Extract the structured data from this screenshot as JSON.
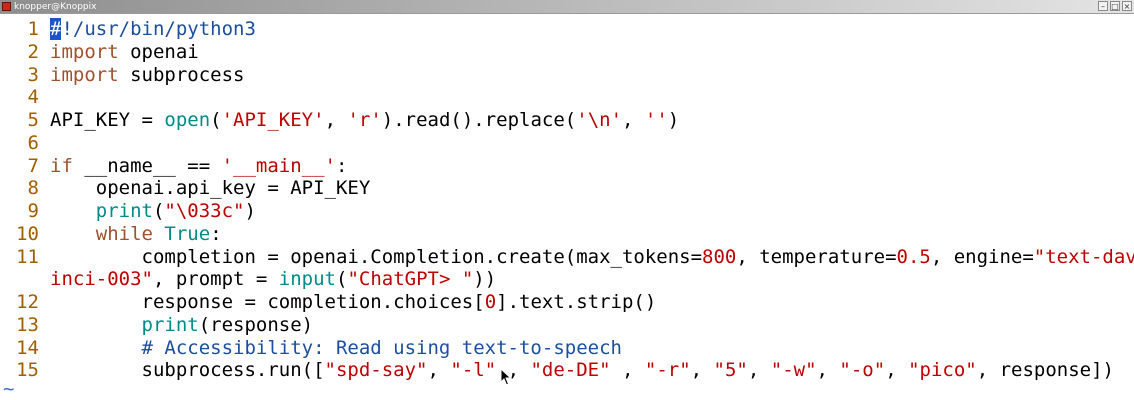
{
  "window": {
    "title": "knopper@Knoppix",
    "buttons": [
      "–",
      "□",
      "×"
    ]
  },
  "editor": {
    "lines": [
      {
        "number": "1",
        "tokens": [
          {
            "t": "#",
            "c": "cursor"
          },
          {
            "t": "!/usr/bin/python3",
            "c": "cm"
          }
        ]
      },
      {
        "number": "2",
        "tokens": [
          {
            "t": "import",
            "c": "kw"
          },
          {
            "t": " openai",
            "c": ""
          }
        ]
      },
      {
        "number": "3",
        "tokens": [
          {
            "t": "import",
            "c": "kw"
          },
          {
            "t": " subprocess",
            "c": ""
          }
        ]
      },
      {
        "number": "4",
        "tokens": []
      },
      {
        "number": "5",
        "tokens": [
          {
            "t": "API_KEY = ",
            "c": ""
          },
          {
            "t": "open",
            "c": "bi"
          },
          {
            "t": "(",
            "c": ""
          },
          {
            "t": "'API_KEY'",
            "c": "st"
          },
          {
            "t": ", ",
            "c": ""
          },
          {
            "t": "'r'",
            "c": "st"
          },
          {
            "t": ").read().replace(",
            "c": ""
          },
          {
            "t": "'\\n'",
            "c": "st"
          },
          {
            "t": ", ",
            "c": ""
          },
          {
            "t": "''",
            "c": "st"
          },
          {
            "t": ")",
            "c": ""
          }
        ]
      },
      {
        "number": "6",
        "tokens": []
      },
      {
        "number": "7",
        "tokens": [
          {
            "t": "if",
            "c": "kw"
          },
          {
            "t": " __name__ == ",
            "c": ""
          },
          {
            "t": "'__main__'",
            "c": "st"
          },
          {
            "t": ":",
            "c": ""
          }
        ]
      },
      {
        "number": "8",
        "tokens": [
          {
            "t": "    openai.api_key = API_KEY",
            "c": ""
          }
        ]
      },
      {
        "number": "9",
        "tokens": [
          {
            "t": "    ",
            "c": ""
          },
          {
            "t": "print",
            "c": "bi"
          },
          {
            "t": "(",
            "c": ""
          },
          {
            "t": "\"\\033c\"",
            "c": "st"
          },
          {
            "t": ")",
            "c": ""
          }
        ]
      },
      {
        "number": "10",
        "tokens": [
          {
            "t": "    ",
            "c": ""
          },
          {
            "t": "while",
            "c": "kw"
          },
          {
            "t": " ",
            "c": ""
          },
          {
            "t": "True",
            "c": "bi"
          },
          {
            "t": ":",
            "c": ""
          }
        ]
      },
      {
        "number": "11",
        "tokens": [
          {
            "t": "        completion = openai.Completion.create(max_tokens=",
            "c": ""
          },
          {
            "t": "800",
            "c": "num"
          },
          {
            "t": ", temperature=",
            "c": ""
          },
          {
            "t": "0.5",
            "c": "num"
          },
          {
            "t": ", engine=",
            "c": ""
          },
          {
            "t": "\"text-dav",
            "c": "st"
          }
        ]
      },
      {
        "number": "",
        "tokens": [
          {
            "t": "inci-003\"",
            "c": "st"
          },
          {
            "t": ", prompt = ",
            "c": ""
          },
          {
            "t": "input",
            "c": "bi"
          },
          {
            "t": "(",
            "c": ""
          },
          {
            "t": "\"ChatGPT> \"",
            "c": "st"
          },
          {
            "t": "))",
            "c": ""
          }
        ]
      },
      {
        "number": "12",
        "tokens": [
          {
            "t": "        response = completion.choices[",
            "c": ""
          },
          {
            "t": "0",
            "c": "num"
          },
          {
            "t": "].text.strip()",
            "c": ""
          }
        ]
      },
      {
        "number": "13",
        "tokens": [
          {
            "t": "        ",
            "c": ""
          },
          {
            "t": "print",
            "c": "bi"
          },
          {
            "t": "(response)",
            "c": ""
          }
        ]
      },
      {
        "number": "14",
        "tokens": [
          {
            "t": "        # Accessibility: Read using text-to-speech",
            "c": "cm"
          }
        ]
      },
      {
        "number": "15",
        "tokens": [
          {
            "t": "        subprocess.run([",
            "c": ""
          },
          {
            "t": "\"spd-say\"",
            "c": "st"
          },
          {
            "t": ", ",
            "c": ""
          },
          {
            "t": "\"-l\"",
            "c": "st"
          },
          {
            "t": " , ",
            "c": ""
          },
          {
            "t": "\"de-DE\"",
            "c": "st"
          },
          {
            "t": " , ",
            "c": ""
          },
          {
            "t": "\"-r\"",
            "c": "st"
          },
          {
            "t": ", ",
            "c": ""
          },
          {
            "t": "\"5\"",
            "c": "st"
          },
          {
            "t": ", ",
            "c": ""
          },
          {
            "t": "\"-w\"",
            "c": "st"
          },
          {
            "t": ", ",
            "c": ""
          },
          {
            "t": "\"-o\"",
            "c": "st"
          },
          {
            "t": ", ",
            "c": ""
          },
          {
            "t": "\"pico\"",
            "c": "st"
          },
          {
            "t": ", response])",
            "c": ""
          }
        ]
      }
    ],
    "empty_line_marker": "~"
  },
  "colors": {
    "keyword": "#a0522d",
    "string": "#c00000",
    "builtin": "#008b8b",
    "comment": "#1c4fa0",
    "line_number": "#a25f00",
    "cursor": "#1a56c8"
  }
}
